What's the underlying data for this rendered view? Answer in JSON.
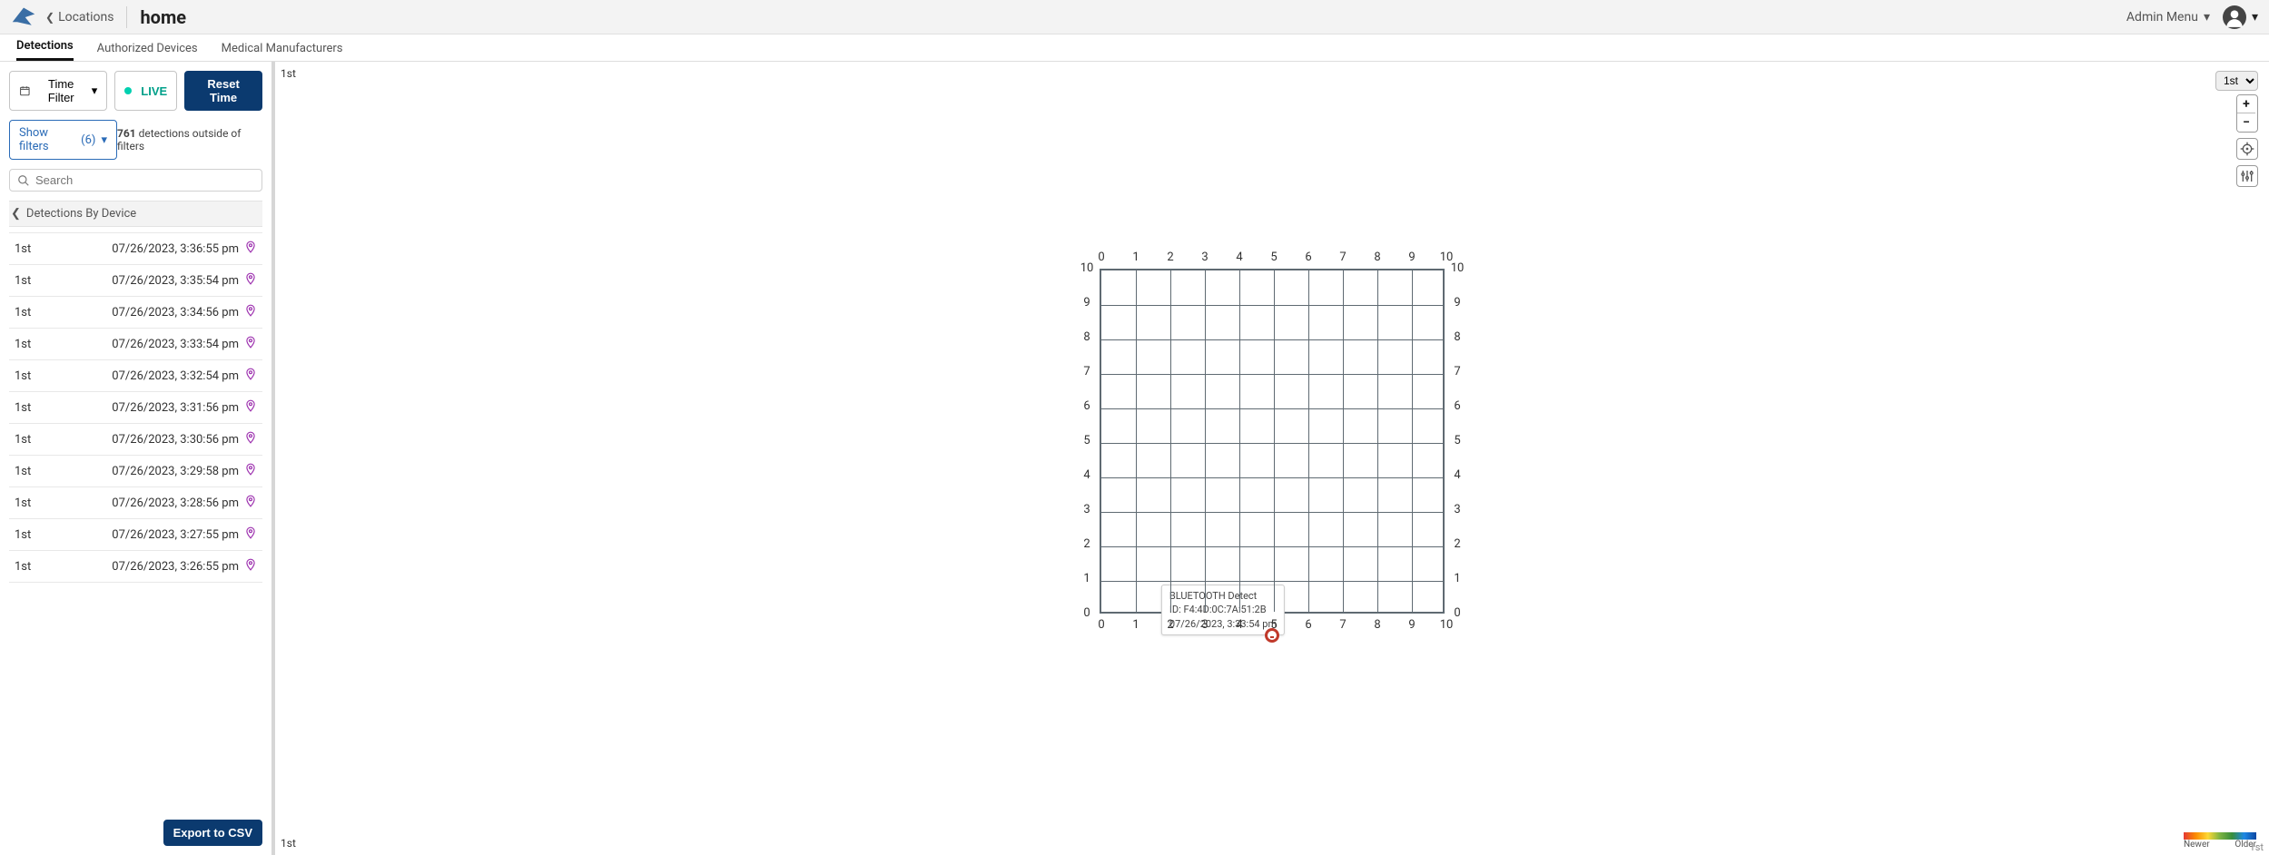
{
  "topbar": {
    "back_label": "Locations",
    "page_title": "home",
    "admin_menu_label": "Admin Menu"
  },
  "tabs": [
    {
      "label": "Detections",
      "active": true
    },
    {
      "label": "Authorized Devices",
      "active": false
    },
    {
      "label": "Medical Manufacturers",
      "active": false
    }
  ],
  "toolbar": {
    "time_filter_label": "Time Filter",
    "live_label": "LIVE",
    "reset_time_label": "Reset Time"
  },
  "filters": {
    "show_filters_label": "Show filters",
    "show_filters_count": "(6)",
    "outside_count": "761",
    "outside_label": "detections outside of filters"
  },
  "search": {
    "placeholder": "Search"
  },
  "detections_header": "Detections By Device",
  "detections": [
    {
      "room": "1st",
      "timestamp": "07/26/2023, 3:36:55 pm"
    },
    {
      "room": "1st",
      "timestamp": "07/26/2023, 3:35:54 pm"
    },
    {
      "room": "1st",
      "timestamp": "07/26/2023, 3:34:56 pm"
    },
    {
      "room": "1st",
      "timestamp": "07/26/2023, 3:33:54 pm"
    },
    {
      "room": "1st",
      "timestamp": "07/26/2023, 3:32:54 pm"
    },
    {
      "room": "1st",
      "timestamp": "07/26/2023, 3:31:56 pm"
    },
    {
      "room": "1st",
      "timestamp": "07/26/2023, 3:30:56 pm"
    },
    {
      "room": "1st",
      "timestamp": "07/26/2023, 3:29:58 pm"
    },
    {
      "room": "1st",
      "timestamp": "07/26/2023, 3:28:56 pm"
    },
    {
      "room": "1st",
      "timestamp": "07/26/2023, 3:27:55 pm"
    },
    {
      "room": "1st",
      "timestamp": "07/26/2023, 3:26:55 pm"
    }
  ],
  "export_label": "Export to CSV",
  "map": {
    "floor_label_top": "1st",
    "floor_label_bottom": "1st",
    "floor_select_value": "1st",
    "axis_ticks": [
      "0",
      "1",
      "2",
      "3",
      "4",
      "5",
      "6",
      "7",
      "8",
      "9",
      "10"
    ],
    "tooltip": {
      "line1": "BLUETOOTH Detect",
      "line2": "ID: F4:4D:0C:7A:51:2B",
      "line3": "07/26/2023, 3:33:54 pm"
    },
    "legend": {
      "newer": "Newer",
      "older": "Older",
      "floor": "1st"
    }
  },
  "colors": {
    "primary": "#0b3a6f",
    "accent": "#2a6bb7",
    "pin": "#9c2fae",
    "marker": "#c0392b",
    "live": "#00d0b0"
  }
}
